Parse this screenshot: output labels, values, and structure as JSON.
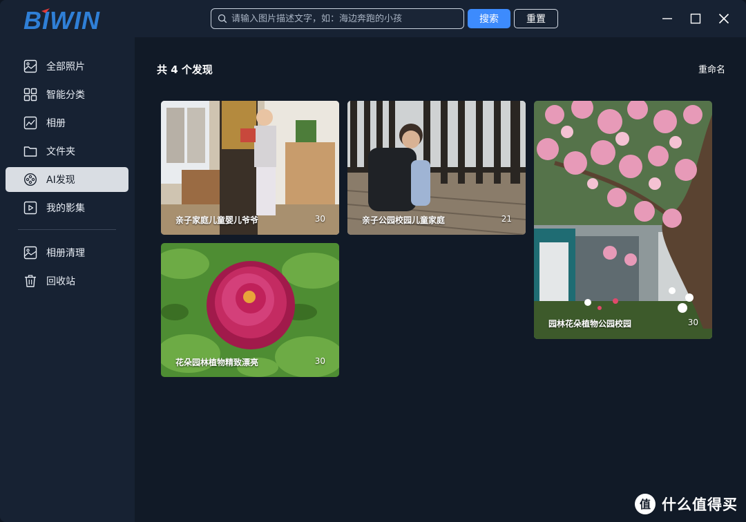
{
  "app": {
    "logo_text": "BIWIN",
    "brand_color": "#2f7fd6",
    "accent_color": "#3d8bfd"
  },
  "search": {
    "placeholder": "请输入图片描述文字，如：海边奔跑的小孩",
    "search_label": "搜索",
    "reset_label": "重置"
  },
  "window_controls": {
    "minimize": "minimize-icon",
    "maximize": "maximize-icon",
    "close": "close-icon"
  },
  "sidebar": {
    "items": [
      {
        "label": "全部照片",
        "icon": "photo-icon"
      },
      {
        "label": "智能分类",
        "icon": "grid-icon"
      },
      {
        "label": "相册",
        "icon": "album-icon"
      },
      {
        "label": "文件夹",
        "icon": "folder-icon"
      },
      {
        "label": "AI发现",
        "icon": "ai-discover-icon",
        "active": true
      },
      {
        "label": "我的影集",
        "icon": "movie-icon"
      },
      {
        "label": "相册清理",
        "icon": "cleanup-icon"
      },
      {
        "label": "回收站",
        "icon": "trash-icon"
      }
    ]
  },
  "main": {
    "count_title": "共 4 个发现",
    "rename_label": "重命名",
    "cards": [
      {
        "caption": "亲子家庭儿童婴儿爷爷",
        "count": "30"
      },
      {
        "caption": "亲子公园校园儿童家庭",
        "count": "21"
      },
      {
        "caption": "园林花朵植物公园校园",
        "count": "30"
      },
      {
        "caption": "花朵园林植物精致漂亮",
        "count": "30"
      }
    ]
  },
  "watermark": {
    "text": "什么值得买",
    "badge": "值"
  }
}
